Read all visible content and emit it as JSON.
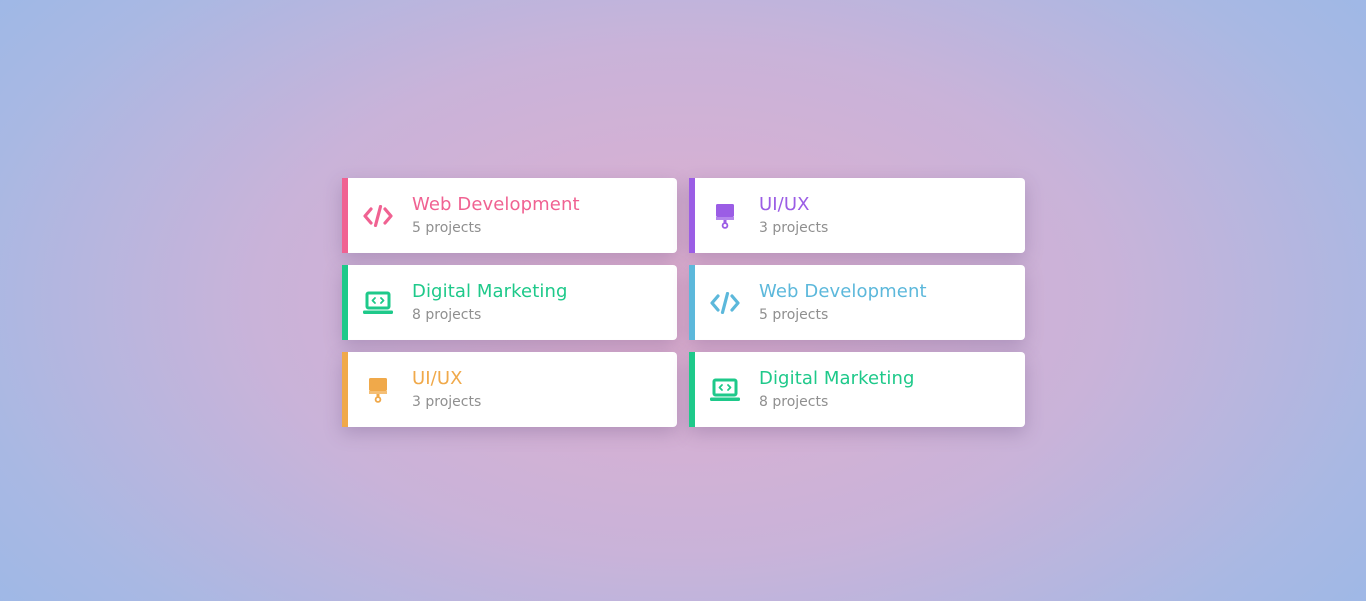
{
  "cards": [
    {
      "title": "Web Development",
      "subtitle": "5 projects",
      "icon": "code-icon",
      "color": "#f06292"
    },
    {
      "title": "UI/UX",
      "subtitle": "3 projects",
      "icon": "paint-brush-icon",
      "color": "#9b5de5"
    },
    {
      "title": "Digital Marketing",
      "subtitle": "8 projects",
      "icon": "laptop-code-icon",
      "color": "#1ec98a"
    },
    {
      "title": "Web Development",
      "subtitle": "5 projects",
      "icon": "code-icon",
      "color": "#5cb8db"
    },
    {
      "title": "UI/UX",
      "subtitle": "3 projects",
      "icon": "paint-brush-icon",
      "color": "#f0a94a"
    },
    {
      "title": "Digital Marketing",
      "subtitle": "8 projects",
      "icon": "laptop-code-icon",
      "color": "#1ec98a"
    }
  ]
}
